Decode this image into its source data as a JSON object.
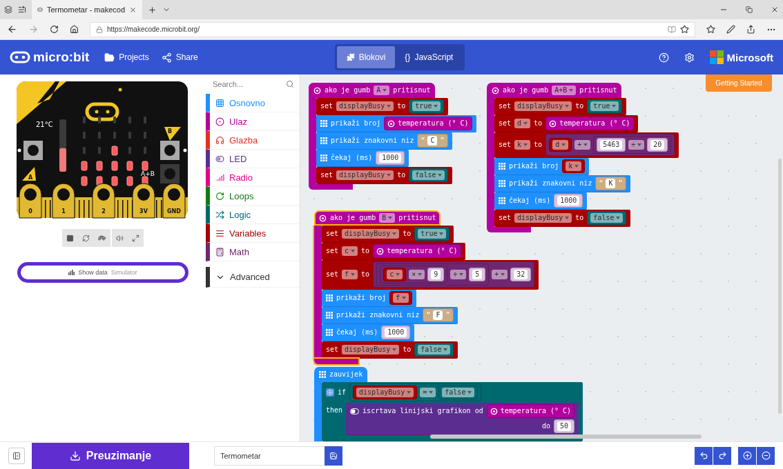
{
  "browser": {
    "tab_title": "Termometar - makecod",
    "url": "https://makecode.microbit.org/"
  },
  "header": {
    "logo": "micro:bit",
    "nav": [
      {
        "label": "Projects"
      },
      {
        "label": "Share"
      }
    ],
    "editor_tabs": [
      {
        "label": "Blokovi",
        "selected": true
      },
      {
        "glyph": "{}",
        "label": "JavaScript",
        "selected": false
      }
    ],
    "brand": "Microsoft"
  },
  "simulator": {
    "temperature": "21°C",
    "level": 0.45,
    "button_labels": [
      "A",
      "B",
      "A+B"
    ],
    "pins": [
      "0",
      "1",
      "2",
      "3V",
      "GND"
    ],
    "leds": [
      {
        "on": false
      },
      {
        "on": false
      },
      {
        "on": false
      },
      {
        "on": false
      },
      {
        "on": false
      },
      {
        "on": false
      },
      {
        "on": false
      },
      {
        "on": false
      },
      {
        "on": false
      },
      {
        "on": false
      },
      {
        "on": false
      },
      {
        "on": false
      },
      {
        "on": true
      },
      {
        "on": false
      },
      {
        "on": false
      },
      {
        "on": true
      },
      {
        "on": true
      },
      {
        "on": true
      },
      {
        "on": true
      },
      {
        "on": true
      },
      {
        "on": true
      },
      {
        "on": true
      },
      {
        "on": true
      },
      {
        "on": true
      },
      {
        "on": true
      }
    ],
    "show_data": {
      "label": "Show data",
      "sub": "Simulator"
    }
  },
  "toolbox": {
    "search_placeholder": "Search...",
    "categories": [
      {
        "label": "Osnovno",
        "color": "#1e90ff"
      },
      {
        "label": "Ulaz",
        "color": "#b4009e"
      },
      {
        "label": "Glazba",
        "color": "#e63022"
      },
      {
        "label": "LED",
        "color": "#5c2d91"
      },
      {
        "label": "Radio",
        "color": "#e3008c"
      },
      {
        "label": "Loops",
        "color": "#107c10"
      },
      {
        "label": "Logic",
        "color": "#006970"
      },
      {
        "label": "Variables",
        "color": "#a80000"
      },
      {
        "label": "Math",
        "color": "#712672"
      }
    ],
    "advanced": {
      "label": "Advanced",
      "color": "#333333"
    }
  },
  "workspace": {
    "getting_started": "Getting Started",
    "stacks": [
      {
        "kind": "input",
        "selected": false,
        "header": [
          {
            "kind": "icon"
          },
          {
            "kind": "text",
            "text": "ako je gumb"
          },
          {
            "kind": "dropdown",
            "text": "A"
          },
          {
            "kind": "text",
            "text": "pritisnut"
          }
        ],
        "body": [
          {
            "kind": "variables",
            "parts": [
              {
                "kind": "text",
                "text": "set"
              },
              {
                "kind": "dropdown",
                "text": "displayBusy"
              },
              {
                "kind": "text",
                "text": "to"
              },
              {
                "kind": "logic",
                "parts": [
                  {
                    "kind": "dropdown",
                    "text": "true"
                  }
                ]
              }
            ]
          },
          {
            "kind": "basic",
            "parts": [
              {
                "kind": "icon"
              },
              {
                "kind": "text",
                "text": "prikaži broj"
              },
              {
                "kind": "input",
                "parts": [
                  {
                    "kind": "icon"
                  },
                  {
                    "kind": "text",
                    "text": "temperatura (° C)"
                  }
                ]
              }
            ]
          },
          {
            "kind": "basic",
            "parts": [
              {
                "kind": "icon"
              },
              {
                "kind": "text",
                "text": "prikaži znakovni niz"
              },
              {
                "kind": "text_value",
                "parts": [
                  {
                    "kind": "text",
                    "text": "“"
                  },
                  {
                    "kind": "field",
                    "text": "C"
                  },
                  {
                    "kind": "text",
                    "text": "”"
                  }
                ]
              }
            ]
          },
          {
            "kind": "basic",
            "parts": [
              {
                "kind": "icon"
              },
              {
                "kind": "text",
                "text": "čekaj (ms)"
              },
              {
                "kind": "number",
                "parts": [
                  {
                    "kind": "field",
                    "text": "1000"
                  }
                ]
              }
            ]
          },
          {
            "kind": "variables",
            "parts": [
              {
                "kind": "text",
                "text": "set"
              },
              {
                "kind": "dropdown",
                "text": "displayBusy"
              },
              {
                "kind": "text",
                "text": "to"
              },
              {
                "kind": "logic",
                "parts": [
                  {
                    "kind": "dropdown",
                    "text": "false"
                  }
                ]
              }
            ]
          }
        ]
      },
      {
        "kind": "input",
        "selected": false,
        "header": [
          {
            "kind": "icon"
          },
          {
            "kind": "text",
            "text": "ako je gumb"
          },
          {
            "kind": "dropdown",
            "text": "A+B"
          },
          {
            "kind": "text",
            "text": "pritisnut"
          }
        ],
        "body": [
          {
            "kind": "variables",
            "parts": [
              {
                "kind": "text",
                "text": "set"
              },
              {
                "kind": "dropdown",
                "text": "displayBusy"
              },
              {
                "kind": "text",
                "text": "to"
              },
              {
                "kind": "logic",
                "parts": [
                  {
                    "kind": "dropdown",
                    "text": "true"
                  }
                ]
              }
            ]
          },
          {
            "kind": "variables",
            "parts": [
              {
                "kind": "text",
                "text": "set"
              },
              {
                "kind": "dropdown",
                "text": "d"
              },
              {
                "kind": "text",
                "text": "to"
              },
              {
                "kind": "input",
                "parts": [
                  {
                    "kind": "icon"
                  },
                  {
                    "kind": "text",
                    "text": "temperatura (° C)"
                  }
                ]
              }
            ]
          },
          {
            "kind": "variables",
            "parts": [
              {
                "kind": "text",
                "text": "set"
              },
              {
                "kind": "dropdown",
                "text": "k"
              },
              {
                "kind": "text",
                "text": "to"
              },
              {
                "kind": "math",
                "parts": [
                  {
                    "kind": "variables",
                    "parts": [
                      {
                        "kind": "dropdown",
                        "text": "d"
                      }
                    ]
                  },
                  {
                    "kind": "dropdown",
                    "text": "+"
                  },
                  {
                    "kind": "math",
                    "parts": [
                      {
                        "kind": "number",
                        "parts": [
                          {
                            "kind": "field",
                            "text": "5463"
                          }
                        ]
                      },
                      {
                        "kind": "dropdown",
                        "text": "÷"
                      },
                      {
                        "kind": "number",
                        "parts": [
                          {
                            "kind": "field",
                            "text": "20"
                          }
                        ]
                      }
                    ]
                  }
                ]
              }
            ]
          },
          {
            "kind": "basic",
            "parts": [
              {
                "kind": "icon"
              },
              {
                "kind": "text",
                "text": "prikaži broj"
              },
              {
                "kind": "variables",
                "parts": [
                  {
                    "kind": "dropdown",
                    "text": "k"
                  }
                ]
              }
            ]
          },
          {
            "kind": "basic",
            "parts": [
              {
                "kind": "icon"
              },
              {
                "kind": "text",
                "text": "prikaži znakovni niz"
              },
              {
                "kind": "text_value",
                "parts": [
                  {
                    "kind": "text",
                    "text": "“"
                  },
                  {
                    "kind": "field",
                    "text": "K"
                  },
                  {
                    "kind": "text",
                    "text": "”"
                  }
                ]
              }
            ]
          },
          {
            "kind": "basic",
            "parts": [
              {
                "kind": "icon"
              },
              {
                "kind": "text",
                "text": "čekaj (ms)"
              },
              {
                "kind": "number",
                "parts": [
                  {
                    "kind": "field",
                    "text": "1000"
                  }
                ]
              }
            ]
          },
          {
            "kind": "variables",
            "parts": [
              {
                "kind": "text",
                "text": "set"
              },
              {
                "kind": "dropdown",
                "text": "displayBusy"
              },
              {
                "kind": "text",
                "text": "to"
              },
              {
                "kind": "logic",
                "parts": [
                  {
                    "kind": "dropdown",
                    "text": "false"
                  }
                ]
              }
            ]
          }
        ]
      },
      {
        "kind": "input",
        "selected": true,
        "header": [
          {
            "kind": "icon"
          },
          {
            "kind": "text",
            "text": "ako je gumb"
          },
          {
            "kind": "dropdown",
            "text": "B"
          },
          {
            "kind": "text",
            "text": "pritisnut"
          }
        ],
        "body": [
          {
            "kind": "variables",
            "parts": [
              {
                "kind": "text",
                "text": "set"
              },
              {
                "kind": "dropdown",
                "text": "displayBusy"
              },
              {
                "kind": "text",
                "text": "to"
              },
              {
                "kind": "logic",
                "parts": [
                  {
                    "kind": "dropdown",
                    "text": "true"
                  }
                ]
              }
            ]
          },
          {
            "kind": "variables",
            "parts": [
              {
                "kind": "text",
                "text": "set"
              },
              {
                "kind": "dropdown",
                "text": "c"
              },
              {
                "kind": "text",
                "text": "to"
              },
              {
                "kind": "input",
                "parts": [
                  {
                    "kind": "icon"
                  },
                  {
                    "kind": "text",
                    "text": "temperatura (° C)"
                  }
                ]
              }
            ]
          },
          {
            "kind": "variables",
            "parts": [
              {
                "kind": "text",
                "text": "set"
              },
              {
                "kind": "dropdown",
                "text": "f"
              },
              {
                "kind": "text",
                "text": "to"
              },
              {
                "kind": "math",
                "parts": [
                  {
                    "kind": "math",
                    "parts": [
                      {
                        "kind": "math",
                        "parts": [
                          {
                            "kind": "variables",
                            "parts": [
                              {
                                "kind": "dropdown",
                                "text": "c"
                              }
                            ]
                          },
                          {
                            "kind": "dropdown",
                            "text": "×"
                          },
                          {
                            "kind": "number",
                            "parts": [
                              {
                                "kind": "field",
                                "text": "9"
                              }
                            ]
                          }
                        ]
                      },
                      {
                        "kind": "dropdown",
                        "text": "÷"
                      },
                      {
                        "kind": "number",
                        "parts": [
                          {
                            "kind": "field",
                            "text": "5"
                          }
                        ]
                      }
                    ]
                  },
                  {
                    "kind": "dropdown",
                    "text": "+"
                  },
                  {
                    "kind": "number",
                    "parts": [
                      {
                        "kind": "field",
                        "text": "32"
                      }
                    ]
                  }
                ]
              }
            ]
          },
          {
            "kind": "basic",
            "parts": [
              {
                "kind": "icon"
              },
              {
                "kind": "text",
                "text": "prikaži broj"
              },
              {
                "kind": "variables",
                "parts": [
                  {
                    "kind": "dropdown",
                    "text": "f"
                  }
                ]
              }
            ]
          },
          {
            "kind": "basic",
            "parts": [
              {
                "kind": "icon"
              },
              {
                "kind": "text",
                "text": "prikaži znakovni niz"
              },
              {
                "kind": "text_value",
                "parts": [
                  {
                    "kind": "text",
                    "text": "“"
                  },
                  {
                    "kind": "field",
                    "text": "F"
                  },
                  {
                    "kind": "text",
                    "text": "”"
                  }
                ]
              }
            ]
          },
          {
            "kind": "basic",
            "parts": [
              {
                "kind": "icon"
              },
              {
                "kind": "text",
                "text": "čekaj (ms)"
              },
              {
                "kind": "number",
                "parts": [
                  {
                    "kind": "field",
                    "text": "1000"
                  }
                ]
              }
            ]
          },
          {
            "kind": "variables",
            "parts": [
              {
                "kind": "text",
                "text": "set"
              },
              {
                "kind": "dropdown",
                "text": "displayBusy"
              },
              {
                "kind": "text",
                "text": "to"
              },
              {
                "kind": "logic",
                "parts": [
                  {
                    "kind": "dropdown",
                    "text": "false"
                  }
                ]
              }
            ]
          }
        ]
      },
      {
        "kind": "basic",
        "selected": false,
        "header": [
          {
            "kind": "icon"
          },
          {
            "kind": "text",
            "text": "zauvijek"
          }
        ],
        "body": [
          {
            "kind": "logic",
            "parts": [
              {
                "kind": "icon"
              },
              {
                "kind": "text",
                "text": "if"
              },
              {
                "kind": "logic",
                "parts": [
                  {
                    "kind": "variables",
                    "parts": [
                      {
                        "kind": "dropdown",
                        "text": "displayBusy"
                      }
                    ]
                  },
                  {
                    "kind": "dropdown",
                    "text": "="
                  },
                  {
                    "kind": "logic",
                    "parts": [
                      {
                        "kind": "dropdown",
                        "text": "false"
                      }
                    ]
                  }
                ]
              }
            ],
            "branches": [
              {
                "label": "then",
                "body": [
                  {
                    "kind": "led",
                    "parts": [
                      {
                        "kind": "icon"
                      },
                      {
                        "kind": "text",
                        "text": "iscrtava linijski grafikon od"
                      },
                      {
                        "kind": "input",
                        "parts": [
                          {
                            "kind": "icon"
                          },
                          {
                            "kind": "text",
                            "text": "temperatura (° C)"
                          }
                        ]
                      }
                    ],
                    "tail": [
                      {
                        "kind": "text",
                        "text": "do"
                      },
                      {
                        "kind": "number",
                        "parts": [
                          {
                            "kind": "field",
                            "text": "50"
                          }
                        ]
                      }
                    ]
                  }
                ]
              }
            ]
          }
        ]
      }
    ]
  },
  "bottom": {
    "download": "Preuzimanje",
    "project_name": "Termometar"
  }
}
